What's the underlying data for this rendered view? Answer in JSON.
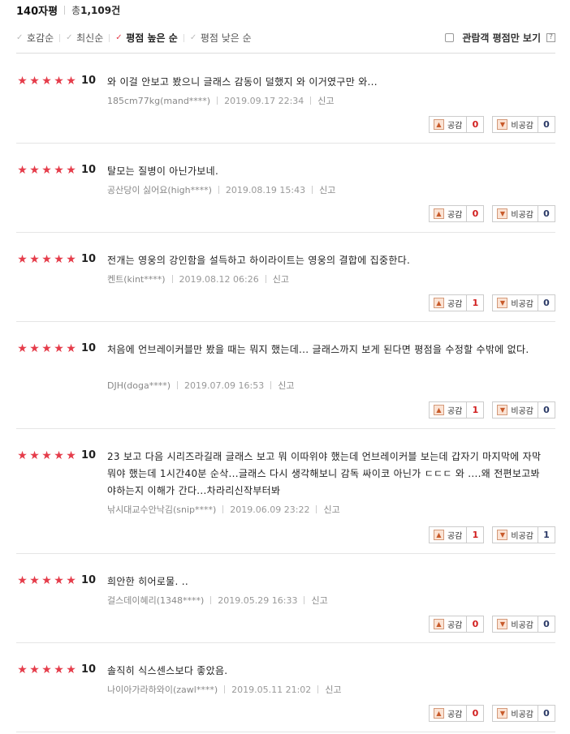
{
  "header": {
    "title": "140자평",
    "count_prefix": "총",
    "count": "1,109건"
  },
  "sort_options": [
    {
      "label": "호감순",
      "active": false
    },
    {
      "label": "최신순",
      "active": false
    },
    {
      "label": "평점 높은 순",
      "active": true
    },
    {
      "label": "평점 낮은 순",
      "active": false
    }
  ],
  "audience_filter": {
    "label": "관람객 평점만 보기",
    "checked": false,
    "help": "?"
  },
  "vote_labels": {
    "like": "공감",
    "dislike": "비공감"
  },
  "report_label": "신고",
  "reviews": [
    {
      "stars": 5,
      "score": "10",
      "text": "와 이걸 안보고 봤으니 글래스 감동이 덜했지 와 이거였구만 와...",
      "author": "185cm77kg(mand****)",
      "date": "2019.09.17 22:34",
      "likes": "0",
      "dislikes": "0"
    },
    {
      "stars": 5,
      "score": "10",
      "text": "탈모는 질병이 아닌가보네.",
      "author": "공산당이 싫어요(high****)",
      "date": "2019.08.19 15:43",
      "likes": "0",
      "dislikes": "0"
    },
    {
      "stars": 5,
      "score": "10",
      "text": "전개는 영웅의 강인함을 설득하고 하이라이트는 영웅의 결합에 집중한다.",
      "author": "켄트(kint****)",
      "date": "2019.08.12 06:26",
      "likes": "1",
      "dislikes": "0"
    },
    {
      "stars": 5,
      "score": "10",
      "text": "처음에 언브레이커블만 봤을 때는 뭐지 했는데... 글래스까지 보게 된다면 평점을 수정할 수밖에 없다.",
      "author": "DJH(doga****)",
      "date": "2019.07.09 16:53",
      "likes": "1",
      "dislikes": "0"
    },
    {
      "stars": 5,
      "score": "10",
      "text": "23 보고 다음 시리즈라길래 글래스 보고 뭐 이따위야 했는데 언브레이커블 보는데 갑자기 마지막에 자막 뭐야 했는데 1시간40분 순삭...글래스 다시 생각해보니 감독 싸이코 아닌가 ㄷㄷㄷ 와 ....왜 전편보고봐야하는지 이해가 간다...차라리신작부터봐",
      "author": "낚시대교수안낙김(snip****)",
      "date": "2019.06.09 23:22",
      "likes": "1",
      "dislikes": "1"
    },
    {
      "stars": 5,
      "score": "10",
      "text": "희안한 히어로물. ..",
      "author": "걸스데이혜리(1348****)",
      "date": "2019.05.29 16:33",
      "likes": "0",
      "dislikes": "0"
    },
    {
      "stars": 5,
      "score": "10",
      "text": "솔직히 식스센스보다 좋았음.",
      "author": "나이아가라하와이(zawl****)",
      "date": "2019.05.11 21:02",
      "likes": "0",
      "dislikes": "0"
    }
  ],
  "colors": {
    "star": "#e53c4a",
    "like_count": "#d11e1e",
    "dislike_count": "#2b3a67"
  }
}
